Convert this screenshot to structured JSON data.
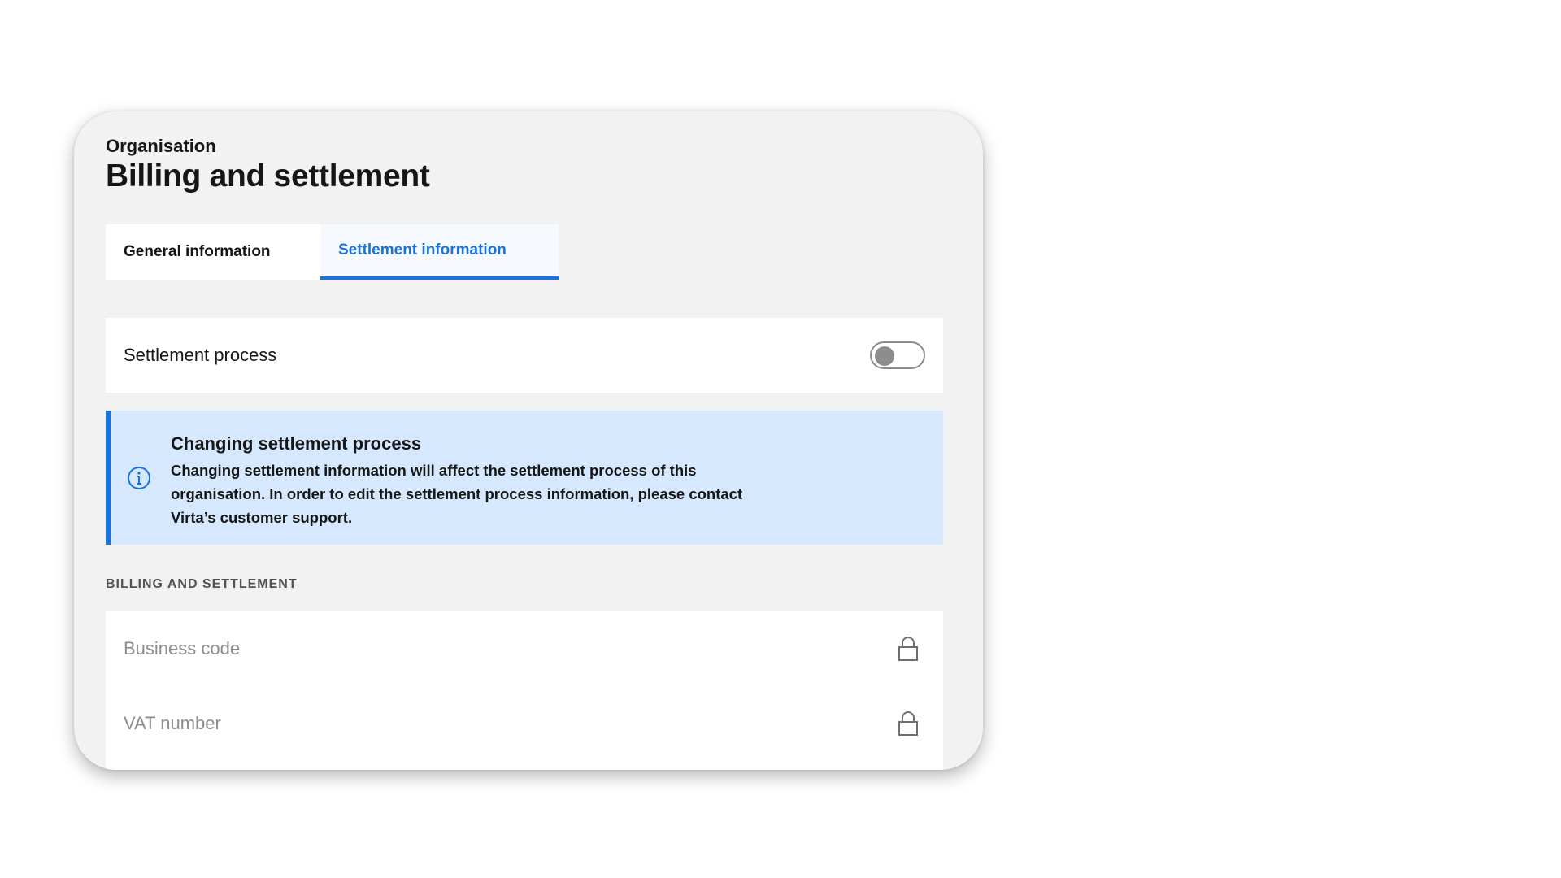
{
  "header": {
    "breadcrumb": "Organisation",
    "title": "Billing and settlement"
  },
  "tabs": [
    {
      "label": "General information",
      "active": false
    },
    {
      "label": "Settlement information",
      "active": true
    }
  ],
  "settlement_process": {
    "label": "Settlement process",
    "enabled": false
  },
  "notice": {
    "icon": "info-icon",
    "title": "Changing settlement process",
    "body": "Changing settlement information will affect the settlement process of this organisation. In order to edit the settlement process information, please contact Virta’s customer support."
  },
  "billing_section": {
    "heading": "BILLING AND SETTLEMENT",
    "fields": [
      {
        "placeholder": "Business code",
        "icon": "lock-icon"
      },
      {
        "placeholder": "VAT number",
        "icon": "lock-icon"
      }
    ]
  },
  "colors": {
    "accent": "#1a73d9",
    "notice_bg": "#d6e8fd",
    "card_bg": "#f2f2f2"
  }
}
